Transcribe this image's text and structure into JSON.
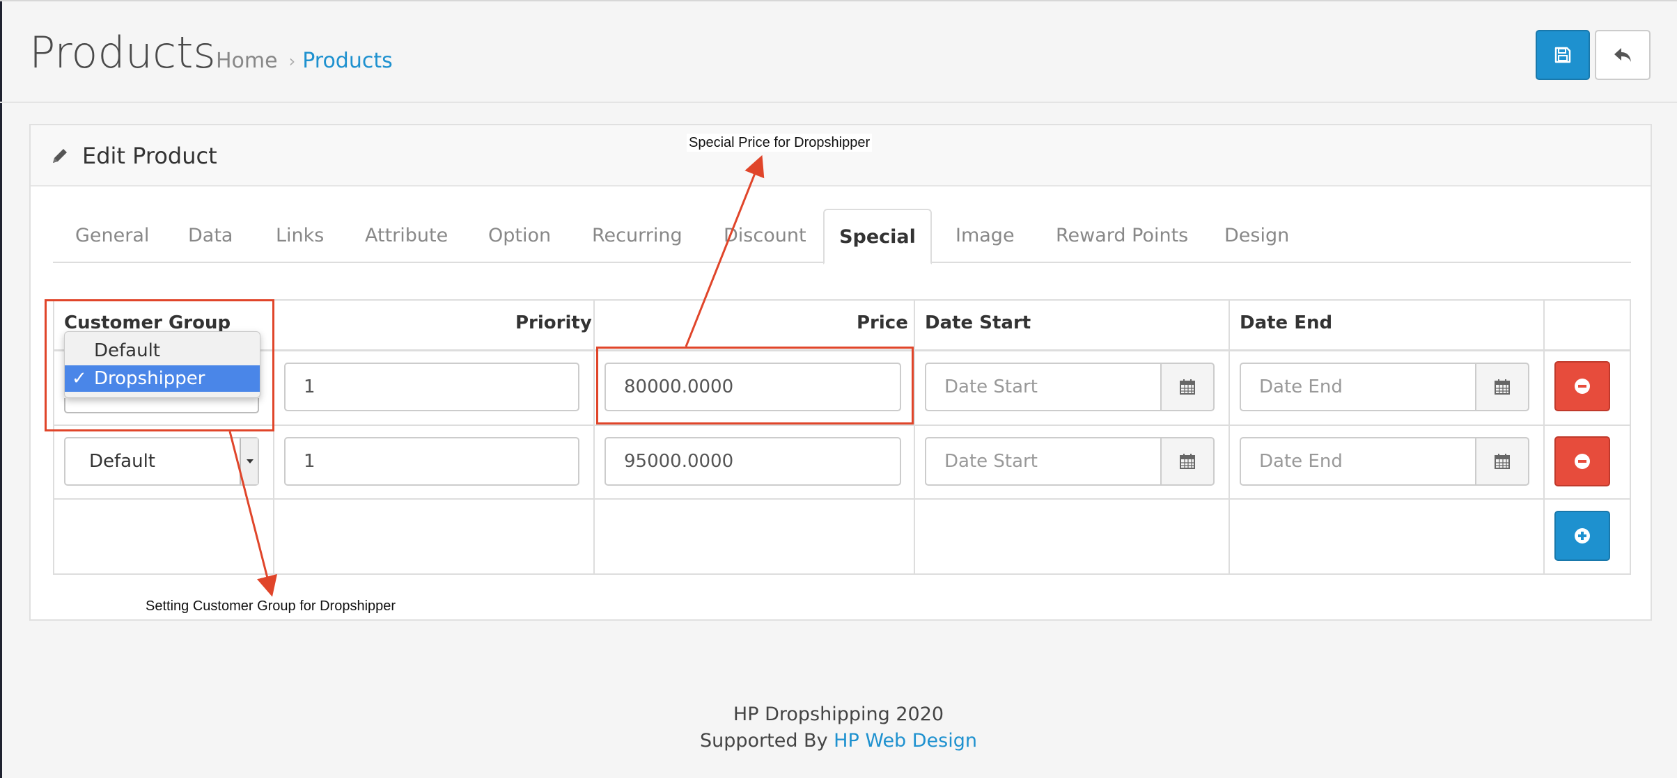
{
  "header": {
    "title": "Products",
    "breadcrumb": [
      {
        "label": "Home"
      },
      {
        "label": "Products"
      }
    ],
    "breadcrumb_separator": "›",
    "save_icon": "floppy-disk-icon",
    "back_icon": "reply-arrow-icon"
  },
  "panel": {
    "title": "Edit Product",
    "title_icon": "pencil-icon"
  },
  "tabs": [
    {
      "label": "General"
    },
    {
      "label": "Data"
    },
    {
      "label": "Links"
    },
    {
      "label": "Attribute"
    },
    {
      "label": "Option"
    },
    {
      "label": "Recurring"
    },
    {
      "label": "Discount"
    },
    {
      "label": "Special",
      "active": true
    },
    {
      "label": "Image"
    },
    {
      "label": "Reward Points"
    },
    {
      "label": "Design"
    }
  ],
  "table": {
    "headers": {
      "customer_group": "Customer Group",
      "priority": "Priority",
      "price": "Price",
      "date_start": "Date Start",
      "date_end": "Date End"
    },
    "rows": [
      {
        "customer_group": "Dropshipper",
        "priority": "1",
        "price": "80000.0000",
        "date_start_placeholder": "Date Start",
        "date_end_placeholder": "Date End"
      },
      {
        "customer_group": "Default",
        "priority": "1",
        "price": "95000.0000",
        "date_start_placeholder": "Date Start",
        "date_end_placeholder": "Date End"
      }
    ],
    "dropdown_options": [
      {
        "label": "Default",
        "selected": false
      },
      {
        "label": "Dropshipper",
        "selected": true
      }
    ],
    "dropdown_check": "✓"
  },
  "annotations": {
    "special_price": "Special Price for Dropshipper",
    "customer_group": "Setting Customer Group for Dropshipper",
    "color": "#e0452a"
  },
  "footer": {
    "line1": "HP Dropshipping 2020",
    "line2_prefix": "Supported By",
    "line2_link": "HP Web Design"
  },
  "colors": {
    "primary": "#1e91cf",
    "danger": "#e74c3c",
    "background": "#f5f5f5"
  }
}
